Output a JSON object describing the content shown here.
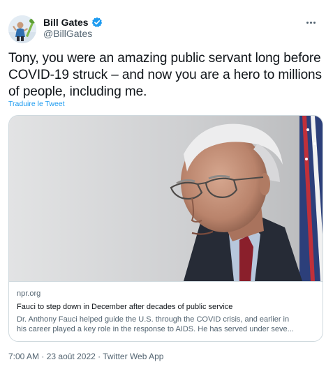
{
  "author": {
    "display_name": "Bill Gates",
    "handle": "@BillGates",
    "verified": true
  },
  "icons": {
    "verified": "verified-badge-icon",
    "more": "more-options-icon"
  },
  "tweet": {
    "text": "Tony, you were an amazing public servant long before COVID-19 struck – and now you are a hero to millions of people, including me.",
    "translate_label": "Traduire le Tweet"
  },
  "card": {
    "domain": "npr.org",
    "title": "Fauci to step down in December after decades of public service",
    "description_line1": "Dr. Anthony Fauci helped guide the U.S. through the COVID crisis, and earlier in",
    "description_line2": "his career played a key role in the response to AIDS. He has served under seve..."
  },
  "meta": {
    "time": "7:00 AM",
    "separator": "·",
    "date": "23 août 2022",
    "source": "Twitter Web App"
  },
  "colors": {
    "accent": "#1d9bf0",
    "text": "#0f1419",
    "secondary": "#536471",
    "border": "#cfd9de"
  }
}
